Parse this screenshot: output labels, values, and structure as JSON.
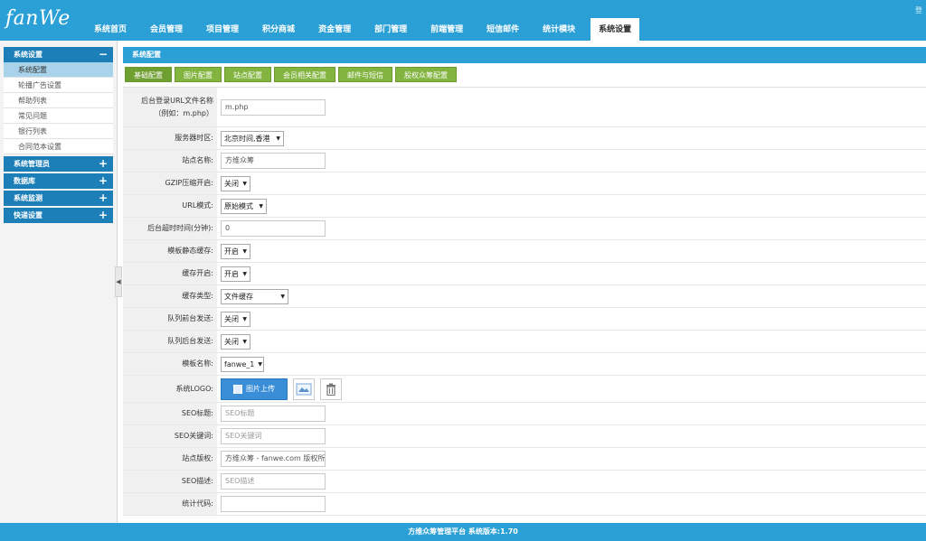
{
  "header": {
    "logo": "fanWe",
    "top_right": "登",
    "nav": [
      {
        "label": "系统首页"
      },
      {
        "label": "会员管理"
      },
      {
        "label": "项目管理"
      },
      {
        "label": "积分商城"
      },
      {
        "label": "资金管理"
      },
      {
        "label": "部门管理"
      },
      {
        "label": "前端管理"
      },
      {
        "label": "短信邮件"
      },
      {
        "label": "统计模块"
      },
      {
        "label": "系统设置"
      }
    ]
  },
  "sidebar": {
    "groups": [
      {
        "title": "系统设置",
        "toggle": "−",
        "items": [
          "系统配置",
          "轮播广告设置",
          "帮助列表",
          "常见问题",
          "银行列表",
          "合同范本设置"
        ]
      },
      {
        "title": "系统管理员",
        "toggle": "+"
      },
      {
        "title": "数据库",
        "toggle": "+"
      },
      {
        "title": "系统监测",
        "toggle": "+"
      },
      {
        "title": "快递设置",
        "toggle": "+"
      }
    ],
    "collapse_glyph": "◀"
  },
  "main": {
    "panel_title": "系统配置",
    "tabs": [
      "基础配置",
      "图片配置",
      "站点配置",
      "会员相关配置",
      "邮件与短信",
      "股权众筹配置"
    ],
    "fields": [
      {
        "label": "后台登录URL文件名称\n（例如：m.php）",
        "value": "m.php"
      },
      {
        "label": "服务器时区:",
        "select": "北京时间,香港"
      },
      {
        "label": "站点名称:",
        "value": "方维众筹"
      },
      {
        "label": "GZIP压缩开启:",
        "select": "关闭"
      },
      {
        "label": "URL模式:",
        "select": "原始模式"
      },
      {
        "label": "后台超时时间(分钟):",
        "value": "0"
      },
      {
        "label": "模板静态缓存:",
        "select": "开启"
      },
      {
        "label": "缓存开启:",
        "select": "开启"
      },
      {
        "label": "缓存类型:",
        "select": "文件缓存"
      },
      {
        "label": "队列前台发送:",
        "select": "关闭"
      },
      {
        "label": "队列后台发送:",
        "select": "关闭"
      },
      {
        "label": "模板名称:",
        "select": "fanwe_1"
      },
      {
        "label": "系统LOGO:",
        "button": "图片上传"
      },
      {
        "label": "SEO标题:",
        "placeholder": "SEO标题"
      },
      {
        "label": "SEO关键词:",
        "placeholder": "SEO关键词"
      },
      {
        "label": "站点版权:",
        "value": "方维众筹 - fanwe.com 版权所有"
      },
      {
        "label": "SEO描述:",
        "placeholder": "SEO描述"
      },
      {
        "label": "统计代码:",
        "value": ""
      }
    ]
  },
  "footer": {
    "text": "方维众筹管理平台 系统版本:1.70"
  },
  "colors": {
    "header": "#2aa0d6",
    "sidebar_head": "#1d7fb8",
    "tab": "#82b43f",
    "active_item": "#a9d3ea"
  }
}
